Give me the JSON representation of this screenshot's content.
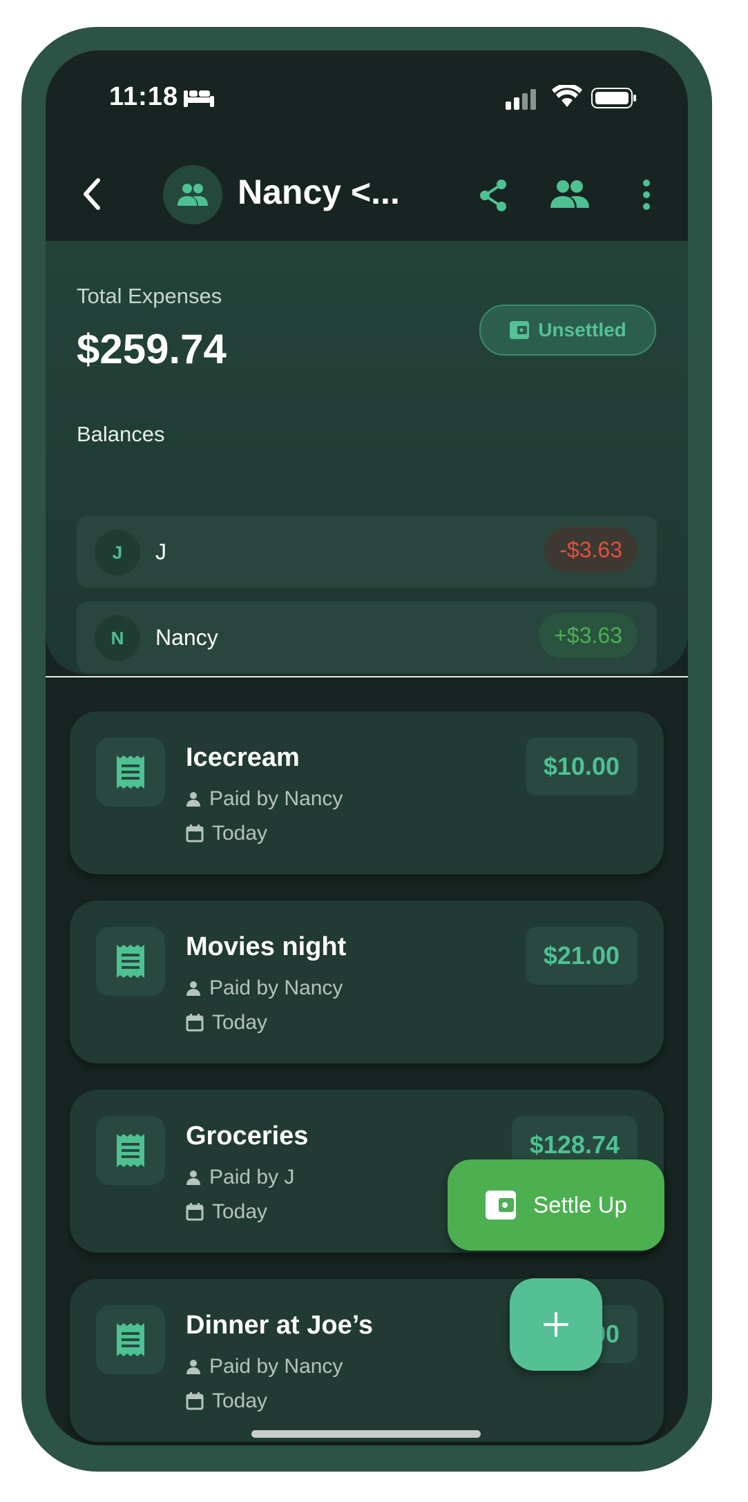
{
  "status_bar": {
    "time": "11:18"
  },
  "header": {
    "group_name": "Nancy <..."
  },
  "summary": {
    "total_label": "Total Expenses",
    "total_value": "$259.74",
    "status_badge": "Unsettled",
    "balances_label": "Balances",
    "balances": [
      {
        "initial": "J",
        "name": "J",
        "amount": "-$3.63",
        "sign": "negative"
      },
      {
        "initial": "N",
        "name": "Nancy",
        "amount": "+$3.63",
        "sign": "positive"
      }
    ]
  },
  "expenses": [
    {
      "title": "Icecream",
      "paid_by": "Paid by Nancy",
      "date": "Today",
      "amount": "$10.00"
    },
    {
      "title": "Movies night",
      "paid_by": "Paid by Nancy",
      "date": "Today",
      "amount": "$21.00"
    },
    {
      "title": "Groceries",
      "paid_by": "Paid by J",
      "date": "Today",
      "amount": "$128.74"
    },
    {
      "title": "Dinner at Joe’s",
      "paid_by": "Paid by Nancy",
      "date": "Today",
      "amount": "$100.00"
    }
  ],
  "actions": {
    "settle_up_label": "Settle Up",
    "add_label": "+"
  },
  "colors": {
    "accent": "#4ec193",
    "settle": "#4caf50",
    "negative": "#e0523b",
    "background": "#172421"
  }
}
